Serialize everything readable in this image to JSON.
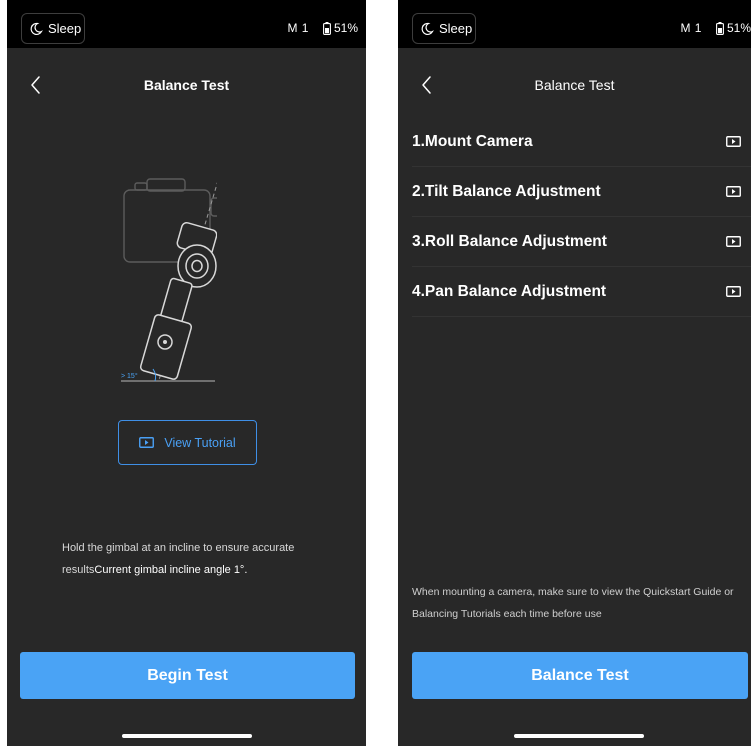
{
  "left_screen": {
    "status_bar": {
      "sleep_label": "Sleep",
      "mode": "M 1",
      "battery": "51%"
    },
    "title": "Balance Test",
    "illustration": {
      "angle_label": "> 15°"
    },
    "view_tutorial_label": "View Tutorial",
    "hint_text": "Hold the gimbal at an incline to ensure accurate results",
    "hint_inline": "Current gimbal incline angle 1°.",
    "begin_test_label": "Begin Test"
  },
  "right_screen": {
    "status_bar": {
      "sleep_label": "Sleep",
      "mode": "M 1",
      "battery": "51%"
    },
    "title": "Balance Test",
    "steps": [
      {
        "label": "1.Mount Camera",
        "icon": "play-video-icon"
      },
      {
        "label": "2.Tilt Balance Adjustment",
        "icon": "play-video-icon"
      },
      {
        "label": "3.Roll Balance Adjustment",
        "icon": "play-video-icon"
      },
      {
        "label": "4.Pan Balance Adjustment",
        "icon": "play-video-icon"
      }
    ],
    "footnote": "When mounting a camera, make sure to view the Quickstart Guide or Balancing Tutorials each time before use",
    "balance_test_label": "Balance Test"
  },
  "colors": {
    "background": "#282828",
    "status_bar": "#000000",
    "accent": "#4aa3f5",
    "tutorial_border": "#3f8fe6"
  }
}
